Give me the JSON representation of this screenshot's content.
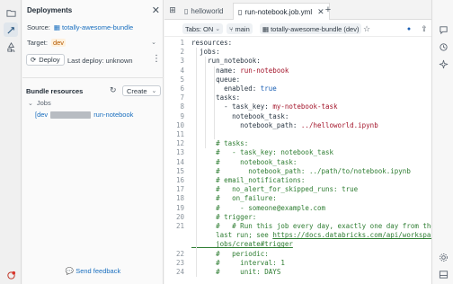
{
  "sidebar": {
    "title": "Deployments",
    "source_label": "Source:",
    "source_value": "totally-awesome-bundle",
    "target_label": "Target:",
    "target_value": "dev",
    "deploy_label": "Deploy",
    "last_deploy": "Last deploy: unknown",
    "resources_title": "Bundle resources",
    "create_label": "Create",
    "jobs_label": "Jobs",
    "job_prefix": "[dev",
    "job_name": "run-notebook",
    "feedback_label": "Send feedback"
  },
  "tabs": [
    {
      "label": "helloworld"
    },
    {
      "label": "run-notebook.job.yml"
    }
  ],
  "toolbar": {
    "tabs_label": "Tabs: ON",
    "branch_label": "main",
    "bundle_label": "totally-awesome-bundle (dev)"
  },
  "code": [
    {
      "n": "1",
      "segs": [
        [
          "k",
          "resources:"
        ]
      ]
    },
    {
      "n": "2",
      "segs": [
        [
          "k",
          "  jobs:"
        ]
      ]
    },
    {
      "n": "3",
      "segs": [
        [
          "k",
          "    run_notebook:"
        ]
      ]
    },
    {
      "n": "4",
      "segs": [
        [
          "k",
          "      name: "
        ],
        [
          "s",
          "run-notebook"
        ]
      ]
    },
    {
      "n": "5",
      "segs": [
        [
          "k",
          "      queue:"
        ]
      ]
    },
    {
      "n": "6",
      "segs": [
        [
          "k",
          "        enabled: "
        ],
        [
          "b",
          "true"
        ]
      ]
    },
    {
      "n": "7",
      "segs": [
        [
          "k",
          "      tasks:"
        ]
      ]
    },
    {
      "n": "8",
      "segs": [
        [
          "k",
          "        - task_key: "
        ],
        [
          "s",
          "my-notebook-task"
        ]
      ]
    },
    {
      "n": "9",
      "segs": [
        [
          "k",
          "          notebook_task:"
        ]
      ]
    },
    {
      "n": "10",
      "segs": [
        [
          "k",
          "            notebook_path: "
        ],
        [
          "s",
          "../helloworld.ipynb"
        ]
      ]
    },
    {
      "n": "11",
      "segs": []
    },
    {
      "n": "12",
      "segs": [
        [
          "c",
          "      # tasks:"
        ]
      ]
    },
    {
      "n": "13",
      "segs": [
        [
          "c",
          "      #   - task_key: notebook_task"
        ]
      ]
    },
    {
      "n": "14",
      "segs": [
        [
          "c",
          "      #     notebook_task:"
        ]
      ]
    },
    {
      "n": "15",
      "segs": [
        [
          "c",
          "      #       notebook_path: ../path/to/notebook.ipynb"
        ]
      ]
    },
    {
      "n": "16",
      "segs": [
        [
          "c",
          "      # email_notifications:"
        ]
      ]
    },
    {
      "n": "17",
      "segs": [
        [
          "c",
          "      #   no_alert_for_skipped_runs: true"
        ]
      ]
    },
    {
      "n": "18",
      "segs": [
        [
          "c",
          "      #   on_failure:"
        ]
      ]
    },
    {
      "n": "19",
      "segs": [
        [
          "c",
          "      #     - someone@example.com"
        ]
      ]
    },
    {
      "n": "20",
      "segs": [
        [
          "c",
          "      # trigger:"
        ]
      ]
    },
    {
      "n": "21",
      "segs": [
        [
          "c",
          "      #   # Run this job every day, exactly one day from the"
        ]
      ]
    },
    {
      "n": "",
      "segs": [
        [
          "c",
          "      last run; see "
        ],
        [
          "u",
          "https://docs.databricks.com/api/workspace/"
        ]
      ]
    },
    {
      "n": "",
      "segs": [
        [
          "u",
          "      jobs/create#trigger"
        ]
      ]
    },
    {
      "n": "22",
      "segs": [
        [
          "c",
          "      #   periodic:"
        ]
      ]
    },
    {
      "n": "23",
      "segs": [
        [
          "c",
          "      #     interval: 1"
        ]
      ]
    },
    {
      "n": "24",
      "segs": [
        [
          "c",
          "      #     unit: DAYS"
        ]
      ]
    }
  ]
}
